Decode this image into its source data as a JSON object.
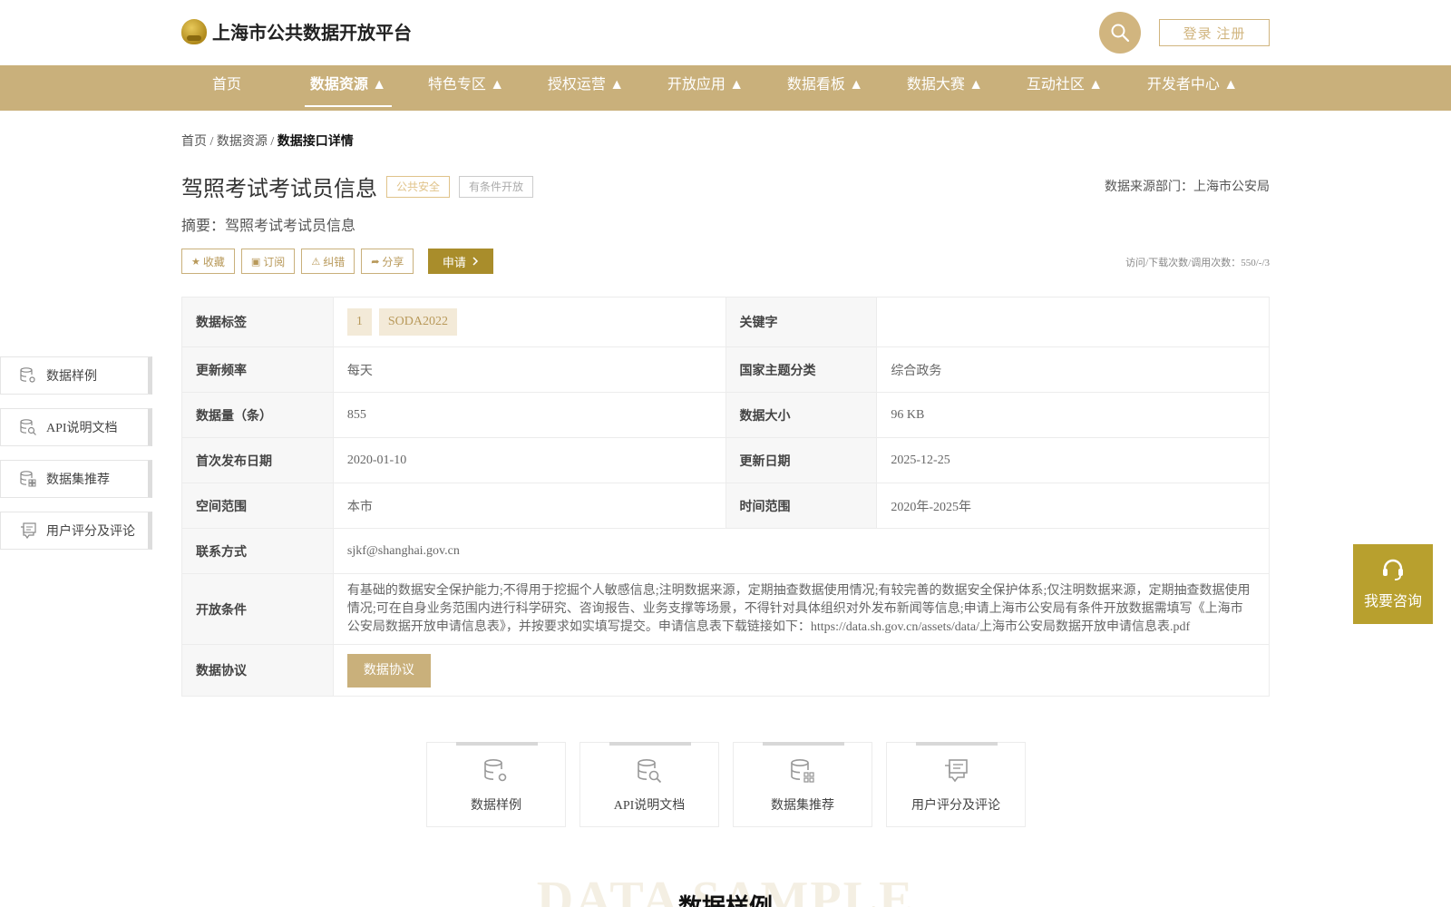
{
  "header": {
    "site_title": "上海市公共数据开放平台",
    "login_label": "登录 注册"
  },
  "nav": {
    "items": [
      {
        "label": "首页"
      },
      {
        "label": "数据资源 ▲"
      },
      {
        "label": "特色专区 ▲"
      },
      {
        "label": "授权运营 ▲"
      },
      {
        "label": "开放应用 ▲"
      },
      {
        "label": "数据看板 ▲"
      },
      {
        "label": "数据大赛 ▲"
      },
      {
        "label": "互动社区 ▲"
      },
      {
        "label": "开发者中心 ▲"
      }
    ],
    "active_index": 1
  },
  "breadcrumb": {
    "home": "首页",
    "sep": "/",
    "resources": "数据资源",
    "current": "数据接口详情"
  },
  "dataset": {
    "title": "驾照考试考试员信息",
    "tag_category": "公共安全",
    "tag_open": "有条件开放",
    "source": "数据来源部门：上海市公安局",
    "abstract": "摘要：驾照考试考试员信息",
    "counts": "访问/下载次数/调用次数：550/-/3"
  },
  "actions": {
    "favorite": "收藏",
    "subscribe": "订阅",
    "correct": "纠错",
    "share": "分享",
    "apply": "申请"
  },
  "info": {
    "tags_label": "数据标签",
    "tags": [
      "1",
      "SODA2022"
    ],
    "keyword_label": "关键字",
    "keyword_value": "",
    "freq_label": "更新频率",
    "freq_value": "每天",
    "theme_label": "国家主题分类",
    "theme_value": "综合政务",
    "count_label": "数据量（条）",
    "count_value": "855",
    "size_label": "数据大小",
    "size_value": "96 KB",
    "first_pub_label": "首次发布日期",
    "first_pub_value": "2020-01-10",
    "update_label": "更新日期",
    "update_value": "2025-12-25",
    "space_label": "空间范围",
    "space_value": "本市",
    "time_label": "时间范围",
    "time_value": "2020年-2025年",
    "contact_label": "联系方式",
    "contact_value": "sjkf@shanghai.gov.cn",
    "condition_label": "开放条件",
    "condition_value": "有基础的数据安全保护能力;不得用于挖掘个人敏感信息;注明数据来源，定期抽查数据使用情况;有较完善的数据安全保护体系;仅注明数据来源，定期抽查数据使用情况;可在自身业务范围内进行科学研究、咨询报告、业务支撑等场景，不得针对具体组织对外发布新闻等信息;申请上海市公安局有条件开放数据需填写《上海市公安局数据开放申请信息表》，并按要求如实填写提交。申请信息表下载链接如下：https://data.sh.gov.cn/assets/data/上海市公安局数据开放申请信息表.pdf",
    "protocol_label": "数据协议",
    "protocol_button": "数据协议"
  },
  "side_menu": [
    {
      "label": "数据样例",
      "icon": "database-gear-icon"
    },
    {
      "label": "API说明文档",
      "icon": "database-search-icon"
    },
    {
      "label": "数据集推荐",
      "icon": "database-grid-icon"
    },
    {
      "label": "用户评分及评论",
      "icon": "comment-icon"
    }
  ],
  "consult": {
    "label": "我要咨询"
  },
  "cards": [
    {
      "label": "数据样例",
      "icon": "database-gear-icon"
    },
    {
      "label": "API说明文档",
      "icon": "database-search-icon"
    },
    {
      "label": "数据集推荐",
      "icon": "database-grid-icon"
    },
    {
      "label": "用户评分及评论",
      "icon": "comment-icon"
    }
  ],
  "section": {
    "watermark": "DATA SAMPLE",
    "title": "数据样例"
  },
  "colors": {
    "gold": "#c9b07b",
    "gold_dark": "#a98d2b",
    "consult": "#b8a02e"
  }
}
